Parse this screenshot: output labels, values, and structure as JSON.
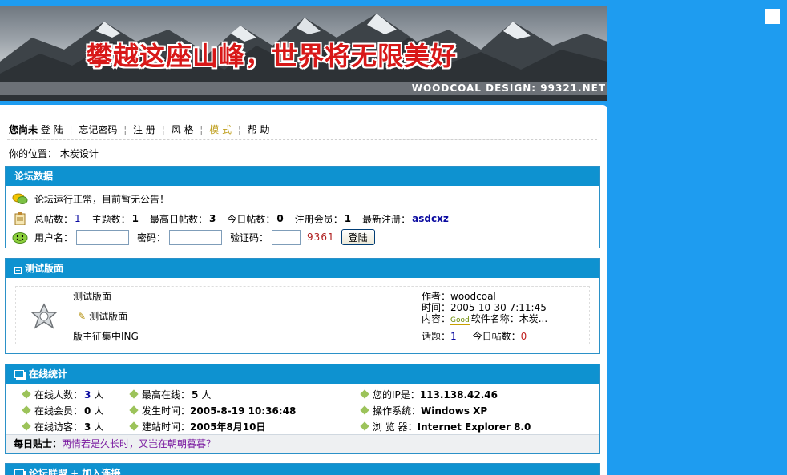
{
  "banner": {
    "slogan": "攀越这座山峰，世界将无限美好",
    "credit": "WOODCOAL DESIGN: 99321.NET"
  },
  "nav": {
    "greeting": "您尚未",
    "items": [
      "登 陆",
      "忘记密码",
      "注 册",
      "风 格",
      "模 式",
      "帮 助"
    ],
    "active_index": 4,
    "separator": "¦",
    "location_label": "你的位置：",
    "location_value": "木炭设计"
  },
  "stats": {
    "title": "论坛数据",
    "notice": "论坛运行正常，目前暂无公告！",
    "total_posts_label": "总帖数：",
    "total_posts": "1",
    "topics_label": "主题数：",
    "topics": "1",
    "max_daily_label": "最高日帖数：",
    "max_daily": "3",
    "today_label": "今日帖数：",
    "today": "0",
    "members_label": "注册会员：",
    "members": "1",
    "newest_label": "最新注册：",
    "newest": "asdcxz",
    "login": {
      "username_label": "用户名：",
      "password_label": "密码：",
      "captcha_label": "验证码：",
      "captcha_code": "9361",
      "submit_label": "登陆",
      "username_value": "",
      "password_value": "",
      "captcha_value": ""
    }
  },
  "forum": {
    "title": "测试版面",
    "name": "测试版面",
    "sub_link": "测试版面",
    "moderator": "版主征集中ING",
    "author_label": "作者：",
    "author": "woodcoal",
    "time_label": "时间：",
    "time": "2005-10-30 7:11:45",
    "content_label": "内容：",
    "good_tag": "Good",
    "content": "软件名称：木炭...",
    "topics_label": "话题：",
    "topics": "1",
    "today_label": "今日帖数：",
    "today": "0"
  },
  "online": {
    "title": "在线统计",
    "online_count_label": "在线人数：",
    "online_count": "3",
    "online_members_label": "在线会员：",
    "online_members": "0",
    "online_guests_label": "在线访客：",
    "online_guests": "3",
    "unit": "人",
    "max_online_label": "最高在线：",
    "max_online": "5",
    "occur_time_label": "发生时间：",
    "occur_time": "2005-8-19 10:36:48",
    "founded_label": "建站时间：",
    "founded": "2005年8月10日",
    "ip_label": "您的IP是：",
    "ip": "113.138.42.46",
    "os_label": "操作系统：",
    "os": "Windows XP",
    "browser_label": "浏 览 器：",
    "browser": "Internet Explorer 8.0",
    "tip_label": "每日贴士：",
    "tip": "两情若是久长时，又岂在朝朝暮暮？"
  },
  "links_box": {
    "title": "论坛联盟 + 加入连接"
  },
  "colors": {
    "page_bg": "#1e9cf0",
    "box_header": "#0e92d0",
    "slogan": "#d81818",
    "accent_link": "#0a0aa0",
    "tip_text": "#7a1aa0"
  }
}
